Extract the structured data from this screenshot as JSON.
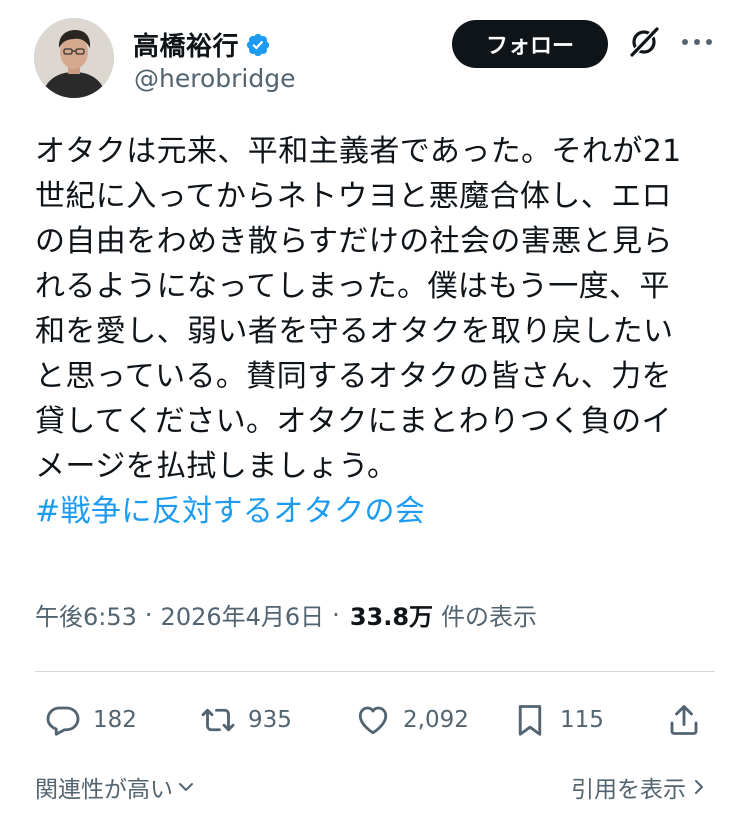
{
  "author": {
    "display_name": "高橋裕行",
    "handle": "@herobridge",
    "verified": true
  },
  "header": {
    "follow_label": "フォロー",
    "icons": [
      "verified-badge-icon",
      "grok-icon",
      "more-icon"
    ]
  },
  "tweet": {
    "lines": [
      "オタクは元来、平和主義者であった。それが21",
      "世紀に入ってからネトウヨと悪魔合体し、エロ",
      "の自由をわめき散らすだけの社会の害悪と見ら",
      "れるようになってしまった。僕はもう一度、平",
      "和を愛し、弱い者を守るオタクを取り戻したい",
      "と思っている。賛同するオタクの皆さん、力を",
      "貸してください。オタクにまとわりつく負のイ",
      "メージを払拭しましょう。"
    ],
    "hashtag": "#戦争に反対するオタクの会"
  },
  "meta": {
    "time": "午後6:53",
    "separator": "·",
    "date": "2026年4月6日",
    "views": "33.8万",
    "views_label": "件の表示"
  },
  "actions": {
    "replies": "182",
    "reposts": "935",
    "likes": "2,092",
    "bookmarks": "115"
  },
  "footer": {
    "sort_label": "関連性が高い",
    "quotes_label": "引用を表示"
  },
  "colors": {
    "text": "#0f1419",
    "secondary": "#536471",
    "link": "#1d9bf0",
    "verified": "#1d9bf0",
    "follow_bg": "#0f1419"
  }
}
